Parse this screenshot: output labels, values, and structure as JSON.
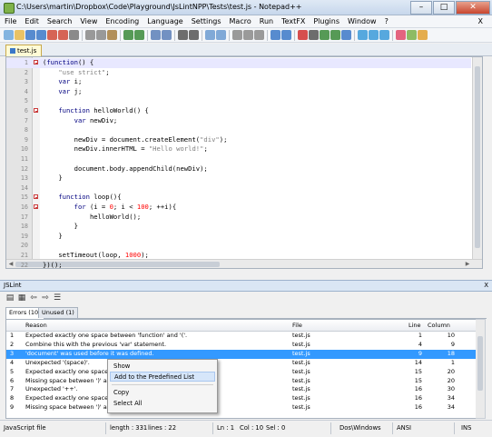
{
  "window": {
    "title": "C:\\Users\\martin\\Dropbox\\Code\\Playground\\JsLintNPP\\Tests\\test.js - Notepad++",
    "min": "–",
    "max": "□",
    "close": "✕"
  },
  "menu": [
    "File",
    "Edit",
    "Search",
    "View",
    "Encoding",
    "Language",
    "Settings",
    "Macro",
    "Run",
    "TextFX",
    "Plugins",
    "Window",
    "?"
  ],
  "menu_close": "X",
  "toolbar_icons": [
    "new-file-icon",
    "open-icon",
    "save-icon",
    "save-all-icon",
    "close-icon",
    "close-all-icon",
    "print-icon",
    "cut-icon",
    "copy-icon",
    "paste-icon",
    "undo-icon",
    "redo-icon",
    "find-icon",
    "replace-icon",
    "zoom-in-icon",
    "zoom-out-icon",
    "sync-v-icon",
    "sync-h-icon",
    "wrap-icon",
    "all-chars-icon",
    "indent-guide-icon",
    "lang-icon",
    "doc-map-icon",
    "record-icon",
    "stop-icon",
    "play-icon",
    "play-multi-icon",
    "save-macro-icon",
    "jslint-icon",
    "prev-icon",
    "next-icon",
    "heart-icon",
    "check-icon",
    "pencil-icon"
  ],
  "toolbar_colors": [
    "#6fa8dc",
    "#e6b84a",
    "#3b78c8",
    "#3b78c8",
    "#d04a3a",
    "#d04a3a",
    "#777777",
    "#888888",
    "#888888",
    "#a67c3d",
    "#3a8a3a",
    "#3a8a3a",
    "#5b7fb8",
    "#5b7fb8",
    "#555555",
    "#555555",
    "#6b9bd1",
    "#6b9bd1",
    "#8a8a8a",
    "#8a8a8a",
    "#8a8a8a",
    "#3b78c8",
    "#3b78c8",
    "#d03030",
    "#555555",
    "#3a8a3a",
    "#3a8a3a",
    "#3b78c8",
    "#3a9ad9",
    "#3a9ad9",
    "#3a9ad9",
    "#e04a6a",
    "#7bb04a",
    "#e0a030"
  ],
  "tab": {
    "label": "test.js"
  },
  "code_lines": [
    {
      "n": "1",
      "fold": "open",
      "html": "<span class='p'>(</span><span class='k'>function</span><span class='p'>() {</span>"
    },
    {
      "n": "2",
      "html": "    <span class='s'>\"use strict\"</span><span class='p'>;</span>"
    },
    {
      "n": "3",
      "html": "    <span class='k'>var</span> <span class='p'>i;</span>"
    },
    {
      "n": "4",
      "html": "    <span class='k'>var</span> <span class='p'>j;</span>"
    },
    {
      "n": "5",
      "html": ""
    },
    {
      "n": "6",
      "fold": "open",
      "html": "    <span class='k'>function</span> <span class='p'>helloWorld() {</span>"
    },
    {
      "n": "7",
      "html": "        <span class='k'>var</span> <span class='p'>newDiv;</span>"
    },
    {
      "n": "8",
      "html": ""
    },
    {
      "n": "9",
      "html": "        <span class='p'>newDiv = document.createElement(</span><span class='s'>\"div\"</span><span class='p'>);</span>"
    },
    {
      "n": "10",
      "html": "        <span class='p'>newDiv.innerHTML = </span><span class='s'>\"Hello world!\"</span><span class='p'>;</span>"
    },
    {
      "n": "11",
      "html": ""
    },
    {
      "n": "12",
      "html": "        <span class='p'>document.body.appendChild(newDiv);</span>"
    },
    {
      "n": "13",
      "html": "    <span class='p'>}</span>"
    },
    {
      "n": "14",
      "html": ""
    },
    {
      "n": "15",
      "fold": "open",
      "html": "    <span class='k'>function</span> <span class='p'>loop(){</span>"
    },
    {
      "n": "16",
      "fold": "open",
      "html": "        <span class='k'>for</span> <span class='p'>(i = </span><span class='n'>0</span><span class='p'>; i &lt; </span><span class='n'>100</span><span class='p'>; ++i){</span>"
    },
    {
      "n": "17",
      "html": "            <span class='p'>helloWorld();</span>"
    },
    {
      "n": "18",
      "html": "        <span class='p'>}</span>"
    },
    {
      "n": "19",
      "html": "    <span class='p'>}</span>"
    },
    {
      "n": "20",
      "html": ""
    },
    {
      "n": "21",
      "html": "    <span class='p'>setTimeout(loop, </span><span class='n'>1000</span><span class='p'>);</span>"
    },
    {
      "n": "22",
      "html": "<span class='p'>})();</span>"
    }
  ],
  "panel": {
    "title": "JSLint",
    "close": "X",
    "tabs": [
      "Errors (10)",
      "Unused (1)"
    ],
    "columns": {
      "num": "",
      "reason": "Reason",
      "file": "File",
      "line": "Line",
      "col": "Column"
    },
    "rows": [
      {
        "num": "1",
        "reason": "Expected exactly one space between 'function' and '('.",
        "file": "test.js",
        "line": "1",
        "col": "10"
      },
      {
        "num": "2",
        "reason": "Combine this with the previous 'var' statement.",
        "file": "test.js",
        "line": "4",
        "col": "9"
      },
      {
        "num": "3",
        "reason": "'document' was used before it was defined.",
        "file": "test.js",
        "line": "9",
        "col": "18",
        "selected": true
      },
      {
        "num": "4",
        "reason": "Unexpected '(space)'.",
        "file": "test.js",
        "line": "14",
        "col": "1"
      },
      {
        "num": "5",
        "reason": "Expected exactly one space",
        "file": "test.js",
        "line": "15",
        "col": "20"
      },
      {
        "num": "6",
        "reason": "Missing space between ')' a",
        "file": "test.js",
        "line": "15",
        "col": "20"
      },
      {
        "num": "7",
        "reason": "Unexpected '++'.",
        "file": "test.js",
        "line": "16",
        "col": "30"
      },
      {
        "num": "8",
        "reason": "Expected exactly one space",
        "file": "test.js",
        "line": "16",
        "col": "34"
      },
      {
        "num": "9",
        "reason": "Missing space between ')' a",
        "file": "test.js",
        "line": "16",
        "col": "34"
      }
    ]
  },
  "context_menu": [
    "Show",
    "Add to the Predefined List",
    "Copy",
    "Select All"
  ],
  "status": {
    "filetype": "JavaScript file",
    "length": "length : 331",
    "lines": "lines : 22",
    "ln": "Ln : 1",
    "col": "Col : 10",
    "sel": "Sel : 0",
    "eol": "Dos\\Windows",
    "enc": "ANSI",
    "ins": "INS"
  }
}
